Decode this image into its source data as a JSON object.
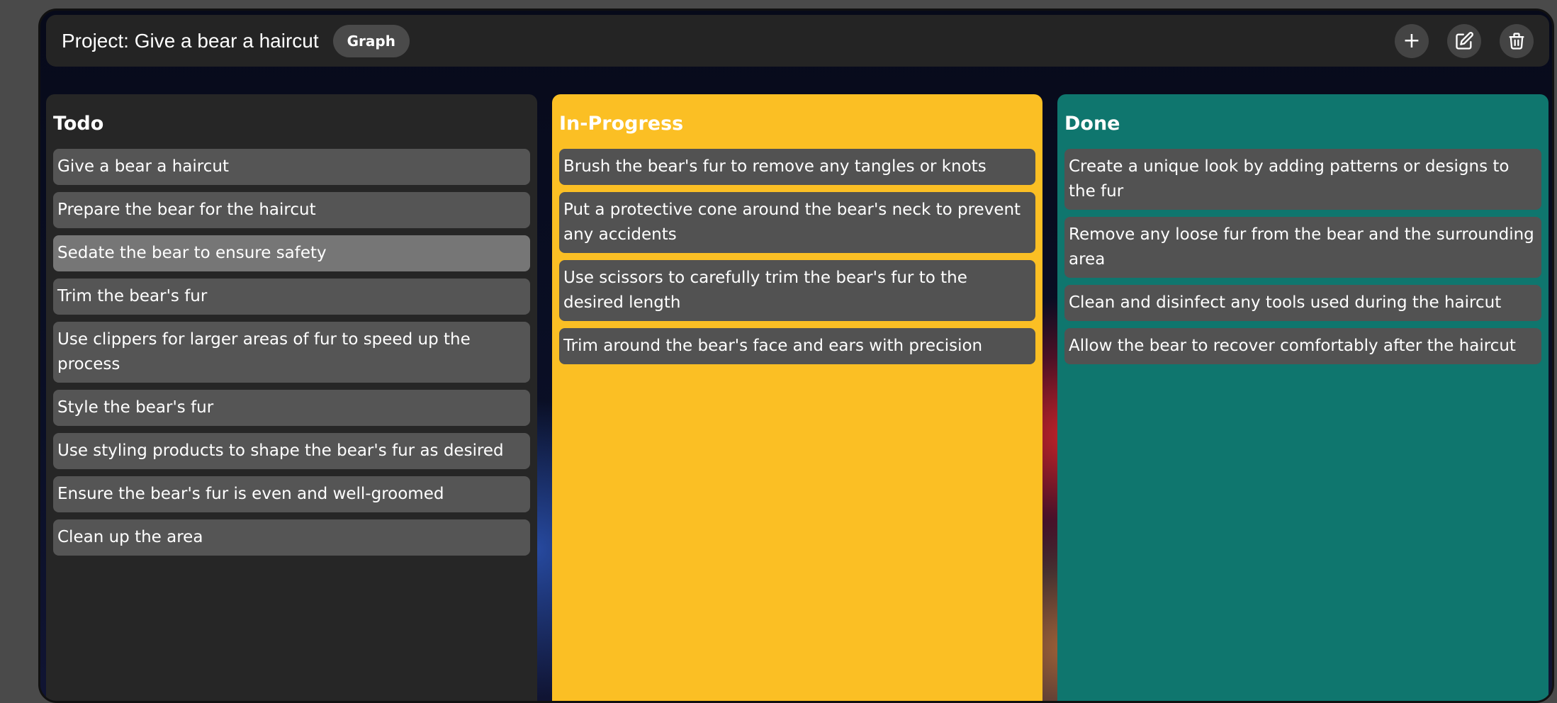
{
  "header": {
    "project_title": "Project: Give a bear a haircut",
    "graph_label": "Graph",
    "add_label": "+"
  },
  "columns": [
    {
      "title": "Todo",
      "cards": [
        "Give a bear a haircut",
        "Prepare the bear for the haircut",
        "Sedate the bear to ensure safety",
        "Trim the bear's fur",
        "Use clippers for larger areas of fur to speed up the process",
        "Style the bear's fur",
        "Use styling products to shape the bear's fur as desired",
        "Ensure the bear's fur is even and well-groomed",
        "Clean up the area"
      ]
    },
    {
      "title": "In-Progress",
      "cards": [
        "Brush the bear's fur to remove any tangles or knots",
        "Put a protective cone around the bear's neck to prevent any accidents",
        "Use scissors to carefully trim the bear's fur to the desired length",
        "Trim around the bear's face and ears with precision"
      ]
    },
    {
      "title": "Done",
      "cards": [
        "Create a unique look by adding patterns or designs to the fur",
        "Remove any loose fur from the bear and the surrounding area",
        "Clean and disinfect any tools used during the haircut",
        "Allow the bear to recover comfortably after the haircut"
      ]
    }
  ],
  "colors": {
    "todo_bg": "#262626",
    "in_progress_bg": "#fbbf24",
    "done_bg": "#0f766e",
    "card_bg": "#555555",
    "card_highlight_bg": "#767676"
  },
  "icons": [
    "plus-icon",
    "edit-icon",
    "trash-icon"
  ]
}
